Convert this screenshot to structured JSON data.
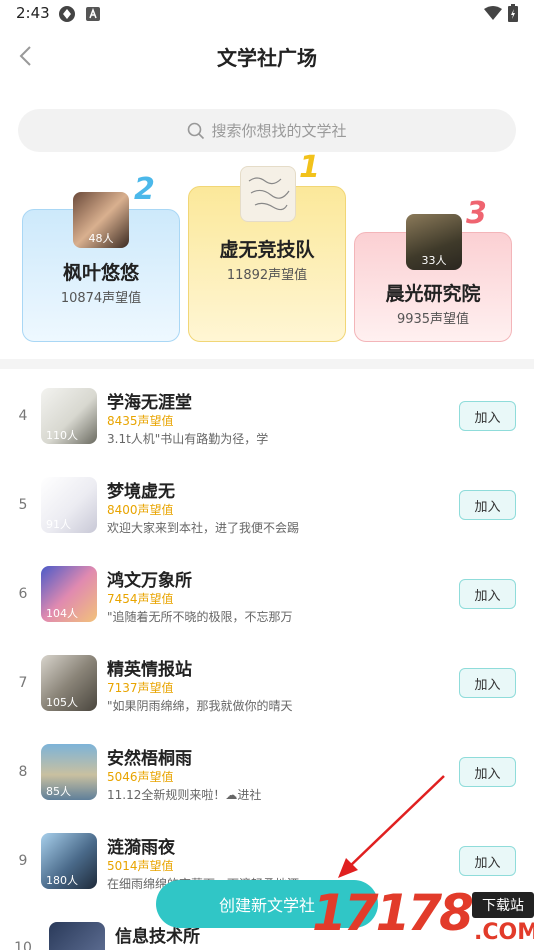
{
  "status": {
    "time": "2:43"
  },
  "nav": {
    "title": "文学社广场"
  },
  "search": {
    "placeholder": "搜索你想找的文学社"
  },
  "podium": [
    {
      "rank": "2",
      "name": "枫叶悠悠",
      "reputation": "10874声望值",
      "members": "48人"
    },
    {
      "rank": "1",
      "name": "虚无竞技队",
      "reputation": "11892声望值",
      "members": ""
    },
    {
      "rank": "3",
      "name": "晨光研究院",
      "reputation": "9935声望值",
      "members": "33人"
    }
  ],
  "list": [
    {
      "rank": "4",
      "name": "学海无涯堂",
      "reputation": "8435声望值",
      "desc": "3.1t人机\"书山有路勤为径，学",
      "members": "110人",
      "join": "加入"
    },
    {
      "rank": "5",
      "name": "梦境虚无",
      "reputation": "8400声望值",
      "desc": "欢迎大家来到本社，进了我便不会踢",
      "members": "91人",
      "join": "加入"
    },
    {
      "rank": "6",
      "name": "鸿文万象所",
      "reputation": "7454声望值",
      "desc": "\"追随着无所不晓的极限，不忘那万",
      "members": "104人",
      "join": "加入"
    },
    {
      "rank": "7",
      "name": "精英情报站",
      "reputation": "7137声望值",
      "desc": "\"如果阴雨绵绵，那我就做你的晴天",
      "members": "105人",
      "join": "加入"
    },
    {
      "rank": "8",
      "name": "安然梧桐雨",
      "reputation": "5046声望值",
      "desc": "11.12全新规则来啦！☁进社",
      "members": "85人",
      "join": "加入"
    },
    {
      "rank": "9",
      "name": "涟漪雨夜",
      "reputation": "5014声望值",
      "desc": "在细雨绵绵的夜幕下，雨滴轻柔地洒",
      "members": "180人",
      "join": "加入"
    },
    {
      "rank": "10",
      "name": "信息技术所",
      "reputation": "",
      "desc": "",
      "members": "",
      "join": ""
    }
  ],
  "create_button": "创建新文学社",
  "watermark": {
    "number": "17178",
    "tag": "下载站",
    "com": ".COM"
  },
  "colors": {
    "accent": "#30c6c6",
    "reputation": "#e8a400",
    "arrow": "#e02020"
  }
}
